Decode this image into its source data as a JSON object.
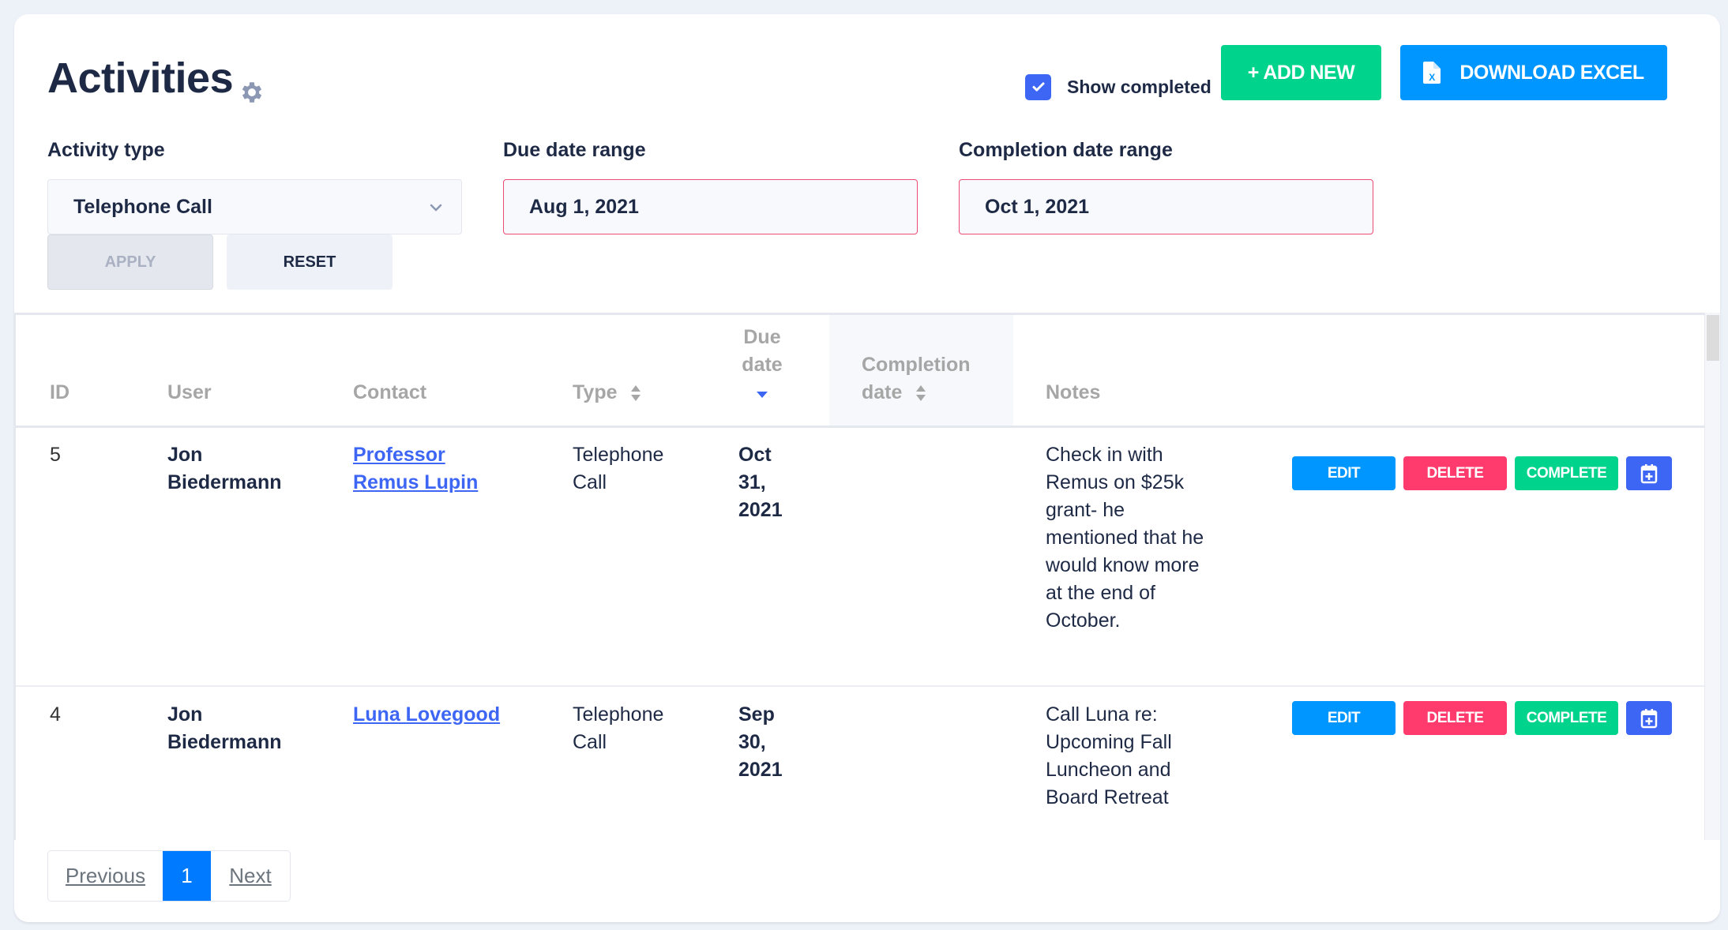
{
  "header": {
    "title": "Activities",
    "settings_icon": "gear-icon",
    "show_completed": {
      "label": "Show completed",
      "checked": true
    },
    "add_new_label": "+ ADD NEW",
    "download_excel_label": "DOWNLOAD EXCEL",
    "download_excel_icon": "excel-file-icon"
  },
  "filters": {
    "activity_type": {
      "label": "Activity type",
      "value": "Telephone Call"
    },
    "due_date_range": {
      "label": "Due date range",
      "value": "Aug 1, 2021"
    },
    "completion_date_range": {
      "label": "Completion date range",
      "value": "Oct 1, 2021"
    },
    "apply_label": "APPLY",
    "reset_label": "RESET"
  },
  "table": {
    "columns": {
      "id": "ID",
      "user": "User",
      "contact": "Contact",
      "type": "Type",
      "due_date_line1": "Due",
      "due_date_line2": "date",
      "completion_date_line1": "Completion",
      "completion_date_line2": "date",
      "notes": "Notes"
    },
    "sorted_column": "Due date",
    "sort_direction": "descending",
    "rows": [
      {
        "id": "5",
        "user_line1": "Jon",
        "user_line2": "Biedermann",
        "contact_line1": "Professor",
        "contact_line2": "Remus Lupin",
        "type_line1": "Telephone",
        "type_line2": "Call",
        "due_line1": "Oct",
        "due_line2": "31,",
        "due_line3": "2021",
        "completion_date": "",
        "notes": [
          "Check in with",
          "Remus on $25k",
          "grant- he",
          "mentioned that he",
          "would know more",
          "at the end of",
          "October."
        ]
      },
      {
        "id": "4",
        "user_line1": "Jon",
        "user_line2": "Biedermann",
        "contact_line1": "Luna Lovegood",
        "contact_line2": "",
        "type_line1": "Telephone",
        "type_line2": "Call",
        "due_line1": "Sep",
        "due_line2": "30,",
        "due_line3": "2021",
        "completion_date": "",
        "notes": [
          "Call Luna re:",
          "Upcoming Fall",
          "Luncheon and",
          "Board Retreat"
        ]
      }
    ],
    "actions": {
      "edit": "EDIT",
      "delete": "DELETE",
      "complete": "COMPLETE",
      "calendar_icon": "calendar-plus-icon"
    }
  },
  "pagination": {
    "previous": "Previous",
    "current": "1",
    "next": "Next"
  },
  "colors": {
    "primary_blue": "#0096ff",
    "add_green": "#00d48c",
    "delete_red": "#ff3b6e",
    "accent_blue": "#3d66f5",
    "error_border": "#ef4a72"
  }
}
